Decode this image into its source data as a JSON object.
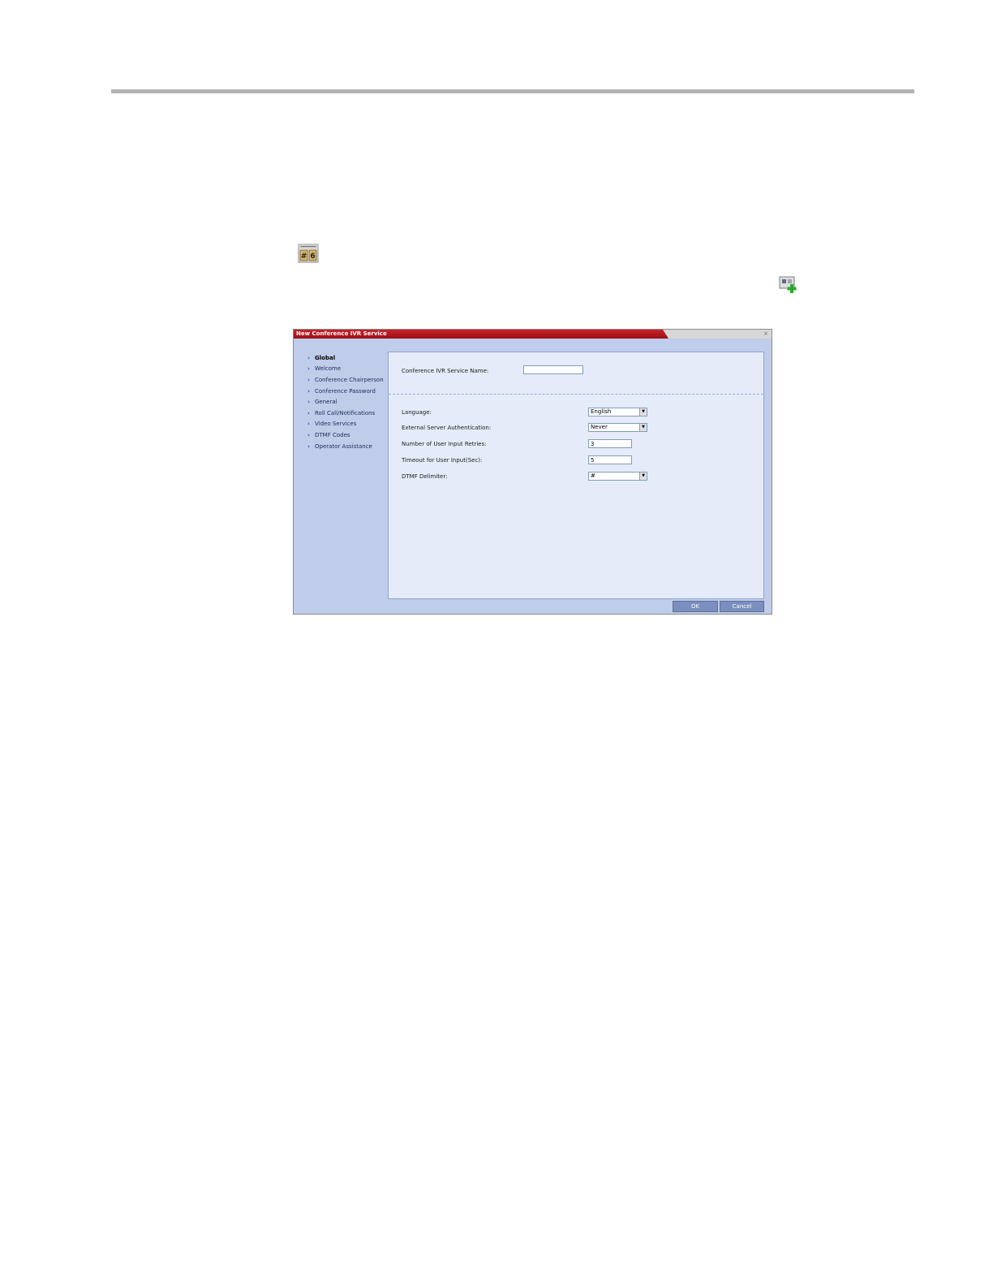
{
  "dialog": {
    "title": "New Conference IVR Service",
    "close_glyph": "×"
  },
  "icons": {
    "ivr": "conference-ivr-icon",
    "new_service": "new-service-icon"
  },
  "nav": {
    "items": [
      {
        "label": "Global",
        "active": true
      },
      {
        "label": "Welcome"
      },
      {
        "label": "Conference Chairperson"
      },
      {
        "label": "Conference Password"
      },
      {
        "label": "General"
      },
      {
        "label": "Roll Call/Notifications"
      },
      {
        "label": "Video Services"
      },
      {
        "label": "DTMF Codes"
      },
      {
        "label": "Operator Assistance"
      }
    ]
  },
  "form": {
    "service_name_label": "Conference IVR Service Name:",
    "service_name_value": "",
    "language_label": "Language:",
    "language_value": "English",
    "ext_auth_label": "External Server Authentication:",
    "ext_auth_value": "Never",
    "retries_label": "Number of User Input Retries:",
    "retries_value": "3",
    "timeout_label": "Timeout for User Input(Sec):",
    "timeout_value": "5",
    "delimiter_label": "DTMF Delimiter:",
    "delimiter_value": "#"
  },
  "buttons": {
    "ok": "OK",
    "cancel": "Cancel"
  }
}
